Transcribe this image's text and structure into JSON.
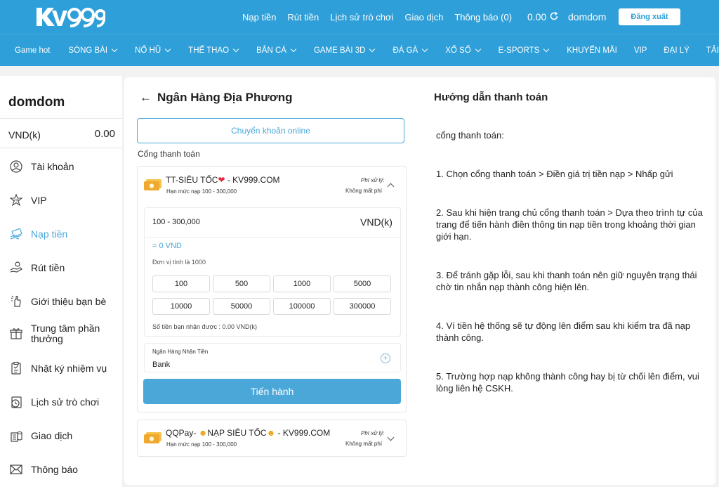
{
  "header": {
    "logo_text": "KV999",
    "nav": [
      "Nạp tiền",
      "Rút tiền",
      "Lịch sử trò chơi",
      "Giao dịch",
      "Thông báo (0)"
    ],
    "balance": "0.00",
    "username": "domdom",
    "logout_label": "Đăng xuất"
  },
  "main_nav": [
    {
      "label": "Game hot",
      "dropdown": false
    },
    {
      "label": "SÒNG BÀI",
      "dropdown": true
    },
    {
      "label": "NỔ HŨ",
      "dropdown": true
    },
    {
      "label": "THỂ THAO",
      "dropdown": true
    },
    {
      "label": "BẮN CÁ",
      "dropdown": true
    },
    {
      "label": "GAME BÀI 3D",
      "dropdown": true
    },
    {
      "label": "ĐÁ GÀ",
      "dropdown": true
    },
    {
      "label": "XỔ SỐ",
      "dropdown": true
    },
    {
      "label": "E-SPORTS",
      "dropdown": true
    },
    {
      "label": "KHUYẾN MÃI",
      "dropdown": false
    },
    {
      "label": "VIP",
      "dropdown": false
    },
    {
      "label": "ĐẠI LÝ",
      "dropdown": false
    },
    {
      "label": "TẢI APP",
      "dropdown": false
    }
  ],
  "sidebar": {
    "username": "domdom",
    "currency": "VND(k)",
    "amount": "0.00",
    "items": [
      {
        "label": "Tài khoản",
        "icon": "user-icon"
      },
      {
        "label": "VIP",
        "icon": "vip-icon"
      },
      {
        "label": "Nạp tiền",
        "icon": "deposit-icon"
      },
      {
        "label": "Rút tiền",
        "icon": "withdraw-icon"
      },
      {
        "label": "Giới thiệu bạn bè",
        "icon": "referral-icon"
      },
      {
        "label": "Trung tâm phần thưởng",
        "icon": "gift-icon"
      },
      {
        "label": "Nhật ký nhiệm vụ",
        "icon": "task-log-icon"
      },
      {
        "label": "Lịch sử trò chơi",
        "icon": "game-history-icon"
      },
      {
        "label": "Giao dịch",
        "icon": "transaction-icon"
      },
      {
        "label": "Thông báo",
        "icon": "mail-icon"
      }
    ],
    "active_index": 2
  },
  "deposit": {
    "title": "Ngân Hàng Địa Phương",
    "method_tab": "Chuyển khoản online",
    "gateway_label": "Cổng thanh toán",
    "gateway1": {
      "name_prefix": "TT-SIÊU TỐC",
      "name_suffix": " - KV999.COM",
      "limit": "Hạn mức nạp 100 - 300,000",
      "fee_label": "Phí xử lý:",
      "fee_value": "Không mất phí"
    },
    "range": "100 - 300,000",
    "unit": "VND(k)",
    "converted": "= 0 VND",
    "unit_note": "Đơn vị tính là 1000",
    "chips": [
      "100",
      "500",
      "1000",
      "5000",
      "10000",
      "50000",
      "100000",
      "300000"
    ],
    "receive_note": "Số tiền bạn nhận được : 0.00 VND(k)",
    "bank_label": "Ngân Hàng Nhận Tiền",
    "bank_value": "Bank",
    "submit_label": "Tiến hành",
    "gateway2": {
      "name_prefix": "QQPay- ",
      "name_middle": "NẠP SIÊU TỐC",
      "name_suffix": " - KV999.COM",
      "limit": "Hạn mức nạp 100 - 300,000",
      "fee_label": "Phí xử lý:",
      "fee_value": "Không mất phí"
    }
  },
  "guide": {
    "title": "Hướng dẫn thanh toán",
    "lines": [
      "cổng thanh toán:",
      "1. Chọn cổng thanh toán > Điền giá trị tiền nạp > Nhấp gửi",
      "2. Sau khi hiện trang chủ cổng thanh toán > Dựa theo trình tự của trang để tiến hành điền thông tin nạp tiền trong khoảng thời gian giới hạn.",
      "3. Để tránh gặp lỗi, sau khi thanh toán nên giữ nguyên trạng thái chờ tin nhắn nạp thành công hiện lên.",
      "4. Ví tiền hệ thống sẽ tự động lên điểm sau khi kiểm tra đã nạp thành công.",
      "5. Trường hợp nạp không thành công hay bị từ chối lên điểm, vui lòng liên hệ CSKH."
    ]
  },
  "colors": {
    "brand": "#2e9fd8",
    "accent": "#4aa7d8"
  }
}
